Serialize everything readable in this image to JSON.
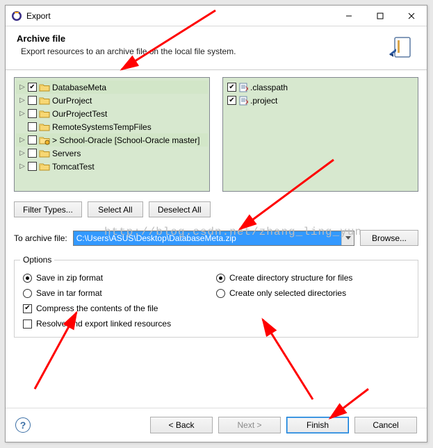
{
  "window": {
    "title": "Export"
  },
  "banner": {
    "title": "Archive file",
    "subtitle": "Export resources to an archive file on the local file system."
  },
  "tree_left": [
    {
      "label": "DatabaseMeta",
      "checked": true,
      "expandable": true,
      "highlight": true
    },
    {
      "label": "OurProject",
      "checked": false,
      "expandable": true
    },
    {
      "label": "OurProjectTest",
      "checked": false,
      "expandable": true
    },
    {
      "label": "RemoteSystemsTempFiles",
      "checked": false,
      "expandable": false
    },
    {
      "label": "> School-Oracle [School-Oracle master]",
      "checked": false,
      "expandable": true,
      "decorated": true,
      "highlight": true
    },
    {
      "label": "Servers",
      "checked": false,
      "expandable": true
    },
    {
      "label": "TomcatTest",
      "checked": false,
      "expandable": true
    }
  ],
  "tree_right": [
    {
      "label": ".classpath",
      "checked": true
    },
    {
      "label": ".project",
      "checked": true
    }
  ],
  "buttons": {
    "filter": "Filter Types...",
    "select_all": "Select All",
    "deselect_all": "Deselect All",
    "browse": "Browse..."
  },
  "path": {
    "label": "To archive file:",
    "value": "C:\\Users\\ASUS\\Desktop\\DatabaseMeta.zip"
  },
  "options": {
    "group_title": "Options",
    "zip": "Save in zip format",
    "tar": "Save in tar format",
    "compress": "Compress the contents of the file",
    "resolve": "Resolve and export linked resources",
    "dir_struct": "Create directory structure for files",
    "only_sel": "Create only selected directories",
    "fmt_selected": "zip",
    "compress_checked": true,
    "resolve_checked": false,
    "dir_mode": "struct"
  },
  "footer": {
    "back": "< Back",
    "next": "Next >",
    "finish": "Finish",
    "cancel": "Cancel"
  },
  "watermark": "http://blog.csdn.net/zhang_ling_yun"
}
